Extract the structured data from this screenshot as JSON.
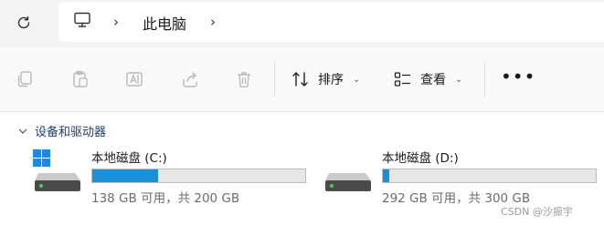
{
  "address": {
    "breadcrumb_separator": "›",
    "location": "此电脑",
    "trailing_separator": "›"
  },
  "toolbar": {
    "buttons": [
      {
        "icon": "copy-icon"
      },
      {
        "icon": "paste-icon"
      },
      {
        "icon": "rename-icon"
      },
      {
        "icon": "share-icon"
      },
      {
        "icon": "delete-icon"
      }
    ],
    "sort_label": "排序",
    "view_label": "查看",
    "more_label": "•••"
  },
  "section": {
    "title": "设备和驱动器"
  },
  "drives": [
    {
      "name": "本地磁盘 (C:)",
      "info": "138 GB 可用，共 200 GB",
      "used_fraction": 0.31,
      "system": true
    },
    {
      "name": "本地磁盘 (D:)",
      "info": "292 GB 可用，共 300 GB",
      "used_fraction": 0.03,
      "system": false
    }
  ],
  "watermark": "CSDN @沙振宇",
  "colors": {
    "accent": "#1b8fd8",
    "section_text": "#1f3b78",
    "windows_logo": "#1e88e5"
  }
}
